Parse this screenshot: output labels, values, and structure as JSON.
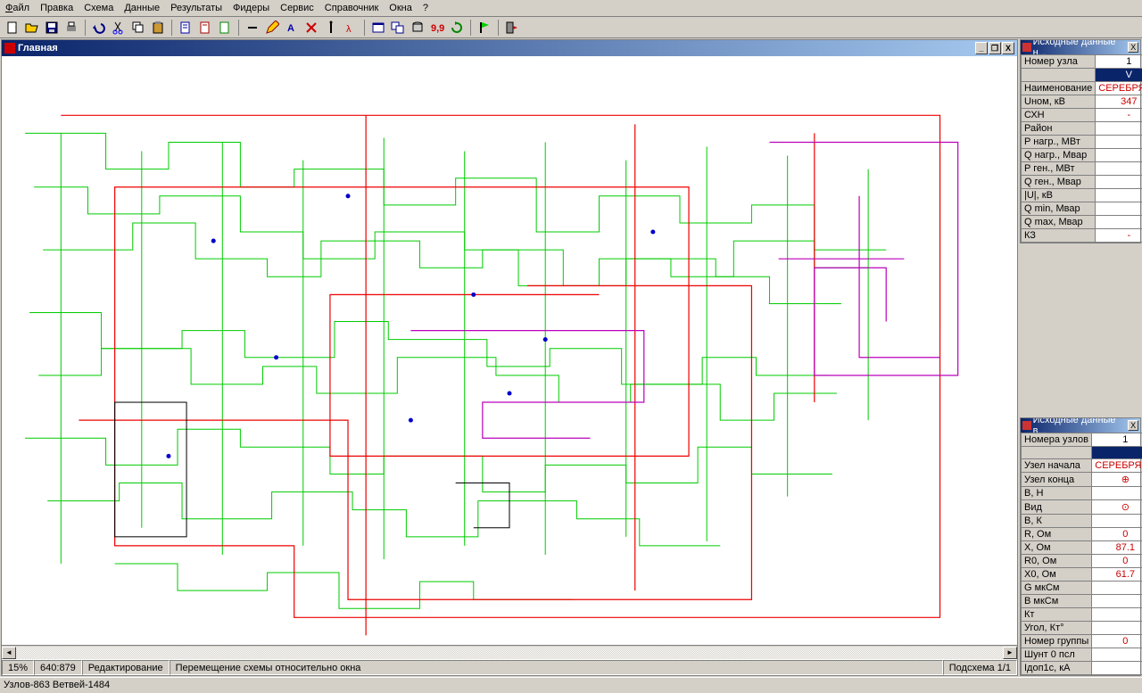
{
  "menu": {
    "file": "Файл",
    "edit": "Правка",
    "schema": "Схема",
    "data": "Данные",
    "results": "Результаты",
    "feeders": "Фидеры",
    "service": "Сервис",
    "reference": "Справочник",
    "windows": "Окна",
    "help": "?"
  },
  "childWindow": {
    "title": "Главная",
    "min": "_",
    "max": "❐",
    "close": "X"
  },
  "status": {
    "zoom": "15%",
    "coords": "640:879",
    "mode": "Редактирование",
    "hint": "Перемещение схемы относительно окна",
    "subscheme": "Подсхема 1/1"
  },
  "status2": "Узлов-863 Ветвей-1484",
  "panel1": {
    "title": "Исходные данные н...",
    "rows": [
      {
        "label": "Номер узла",
        "val": "1",
        "cls": ""
      },
      {
        "label": "",
        "val": "V",
        "cls": "sel"
      },
      {
        "label": "Наименование",
        "val": "СЕРЕБРЯНС",
        "cls": "red"
      },
      {
        "label": "Uном, кВ",
        "val": "347",
        "cls": "red"
      },
      {
        "label": "СХН",
        "val": "-",
        "cls": "red"
      },
      {
        "label": "Район",
        "val": "",
        "cls": ""
      },
      {
        "label": "P нагр., МВт",
        "val": "",
        "cls": ""
      },
      {
        "label": "Q нагр., Мвар",
        "val": "",
        "cls": ""
      },
      {
        "label": "P ген., МВт",
        "val": "",
        "cls": ""
      },
      {
        "label": "Q ген., Мвар",
        "val": "",
        "cls": ""
      },
      {
        "label": "|U|, кВ",
        "val": "",
        "cls": ""
      },
      {
        "label": "Q min, Мвар",
        "val": "",
        "cls": ""
      },
      {
        "label": "Q max, Мвар",
        "val": "",
        "cls": ""
      },
      {
        "label": "КЗ",
        "val": "-",
        "cls": "red"
      }
    ]
  },
  "panel2": {
    "title": "Исходные данные в...",
    "rows": [
      {
        "label": "Номера узлов",
        "val": "1",
        "cls": ""
      },
      {
        "label": "",
        "val": "",
        "cls": "sel"
      },
      {
        "label": "Узел начала",
        "val": "СЕРЕБРЯНС",
        "cls": "red"
      },
      {
        "label": "Узел конца",
        "val": "⊕",
        "cls": "red"
      },
      {
        "label": "В, Н",
        "val": "",
        "cls": ""
      },
      {
        "label": "Вид",
        "val": "⊙",
        "cls": "red"
      },
      {
        "label": "В, К",
        "val": "",
        "cls": ""
      },
      {
        "label": "R, Ом",
        "val": "0",
        "cls": "red"
      },
      {
        "label": "X, Ом",
        "val": "87.1",
        "cls": "red"
      },
      {
        "label": "R0, Ом",
        "val": "0",
        "cls": "red"
      },
      {
        "label": "X0, Ом",
        "val": "61.7",
        "cls": "red"
      },
      {
        "label": "G мкСм",
        "val": "",
        "cls": ""
      },
      {
        "label": "B мкСм",
        "val": "",
        "cls": ""
      },
      {
        "label": "Кт",
        "val": "",
        "cls": ""
      },
      {
        "label": "Угол, Кт°",
        "val": "",
        "cls": ""
      },
      {
        "label": "Номер группы",
        "val": "0",
        "cls": "red"
      },
      {
        "label": "Шунт 0 псл",
        "val": "",
        "cls": ""
      },
      {
        "label": "Iдоп1с, кА",
        "val": "",
        "cls": ""
      }
    ]
  },
  "scroll": {
    "left": "◄",
    "right": "►"
  }
}
